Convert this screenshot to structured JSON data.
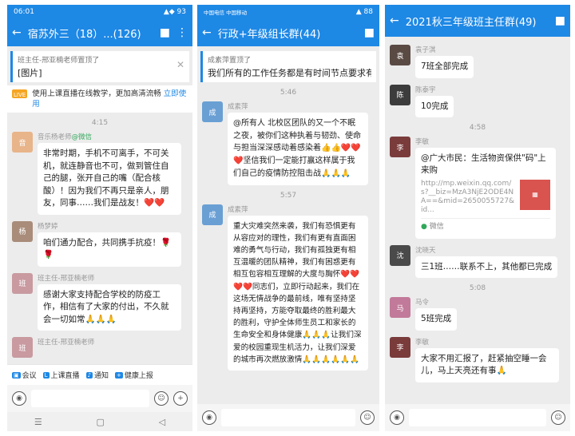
{
  "panel1": {
    "status_time": "06:01",
    "status_right": "▲◆ 93",
    "title": "宿苏外三（18）...(126)",
    "pin_by": "班主任-邢亚楠老师置顶了",
    "pin_msg": "[图片]",
    "live_badge": "LIVE",
    "live_text": "使用上课直播在线教学，更加高清流畅",
    "live_link": "立即使用",
    "time1": "4:15",
    "m1_name": "音乐杨老师",
    "m1_tag": "@微信",
    "m1_text": "非常时期，手机不可离手，不可关机，就连静音也不可，做到管住自己的腿，张开自己的嘴（配合核酸）！因为我们不再只是亲人，朋友，同事……我们是战友！❤️❤️",
    "m2_name": "杨梦婷",
    "m2_text": "咱们通力配合，共同携手抗疫！🌹🌹",
    "m3_name": "班主任-邢亚楠老师",
    "m3_text": "感谢大家支持配合学校的防疫工作，相信有了大家的付出，不久就会一切如常🙏🙏🙏",
    "m4_name": "班主任-邢亚楠老师",
    "tools": [
      "会议",
      "上课直播",
      "通知",
      "健康上报"
    ],
    "nav": [
      "☰",
      "▢",
      "◁"
    ]
  },
  "panel2": {
    "status_left": "中国电信 中国移动",
    "status_right": "▲ 88",
    "title": "行政+年级组长群(44)",
    "pin_by": "成素萍置顶了",
    "pin_msg": "我们所有的工作任务都是有时间节点要求有...",
    "time1": "5:46",
    "m1_name": "成素萍",
    "m1_text": "@所有人 北校区团队的又一个不眠之夜，被你们这种执着与韧劲、使命与担当深深感动着感染着👍👍❤️❤️❤️坚信我们一定能打赢这样属于我们自己的疫情防控阻击战🙏🙏🙏",
    "time2": "5:57",
    "m2_name": "成素萍",
    "m2_text": "重大灾难突然来袭，我们有恐惧更有从容应对的理性，我们有更有直面困难的勇气与行动，我们有孤独更有相互温暖的团队精神，我们有困惑更有相互包容相互理解的大度与胸怀❤️❤️❤️❤️同志们，立即行动起来，我们在这场无情战争的最前线，唯有坚持坚持再坚持，方能夺取最终的胜利最大的胜利，守护全体师生员工和家长的生命安全和身体健康🙏🙏🙏让我们深爱的校园重现生机活力，让我们深爱的城市再次燃放激情🙏🙏🙏🙏🙏🙏"
  },
  "panel3": {
    "title": "2021秋三年级班主任群(49)",
    "m1_name": "袁子淇",
    "m1_text": "7班全部完成",
    "m2_name": "陈泰宇",
    "m2_text": "10完成",
    "time1": "4:58",
    "m3_name": "李敏",
    "m3_link_title": "@广大市民：生活物资保供\"码\"上来购",
    "m3_link_url": "http://mp.weixin.qq.com/s?__biz=MzA3NjE2ODE4NA==&mid=2650055727&id...",
    "m3_link_src": "微信",
    "m4_name": "沈晓天",
    "m4_text": "三1班……联系不上，其他都已完成",
    "time2": "5:08",
    "m5_name": "马令",
    "m5_text": "5班完成",
    "m6_name": "李敏",
    "m6_text": "大家不用汇报了，赶紧抽空睡一会儿，马上天亮还有事🙏"
  },
  "colors": {
    "accent": "#1e88e5",
    "chat_bg": "#ececec"
  }
}
